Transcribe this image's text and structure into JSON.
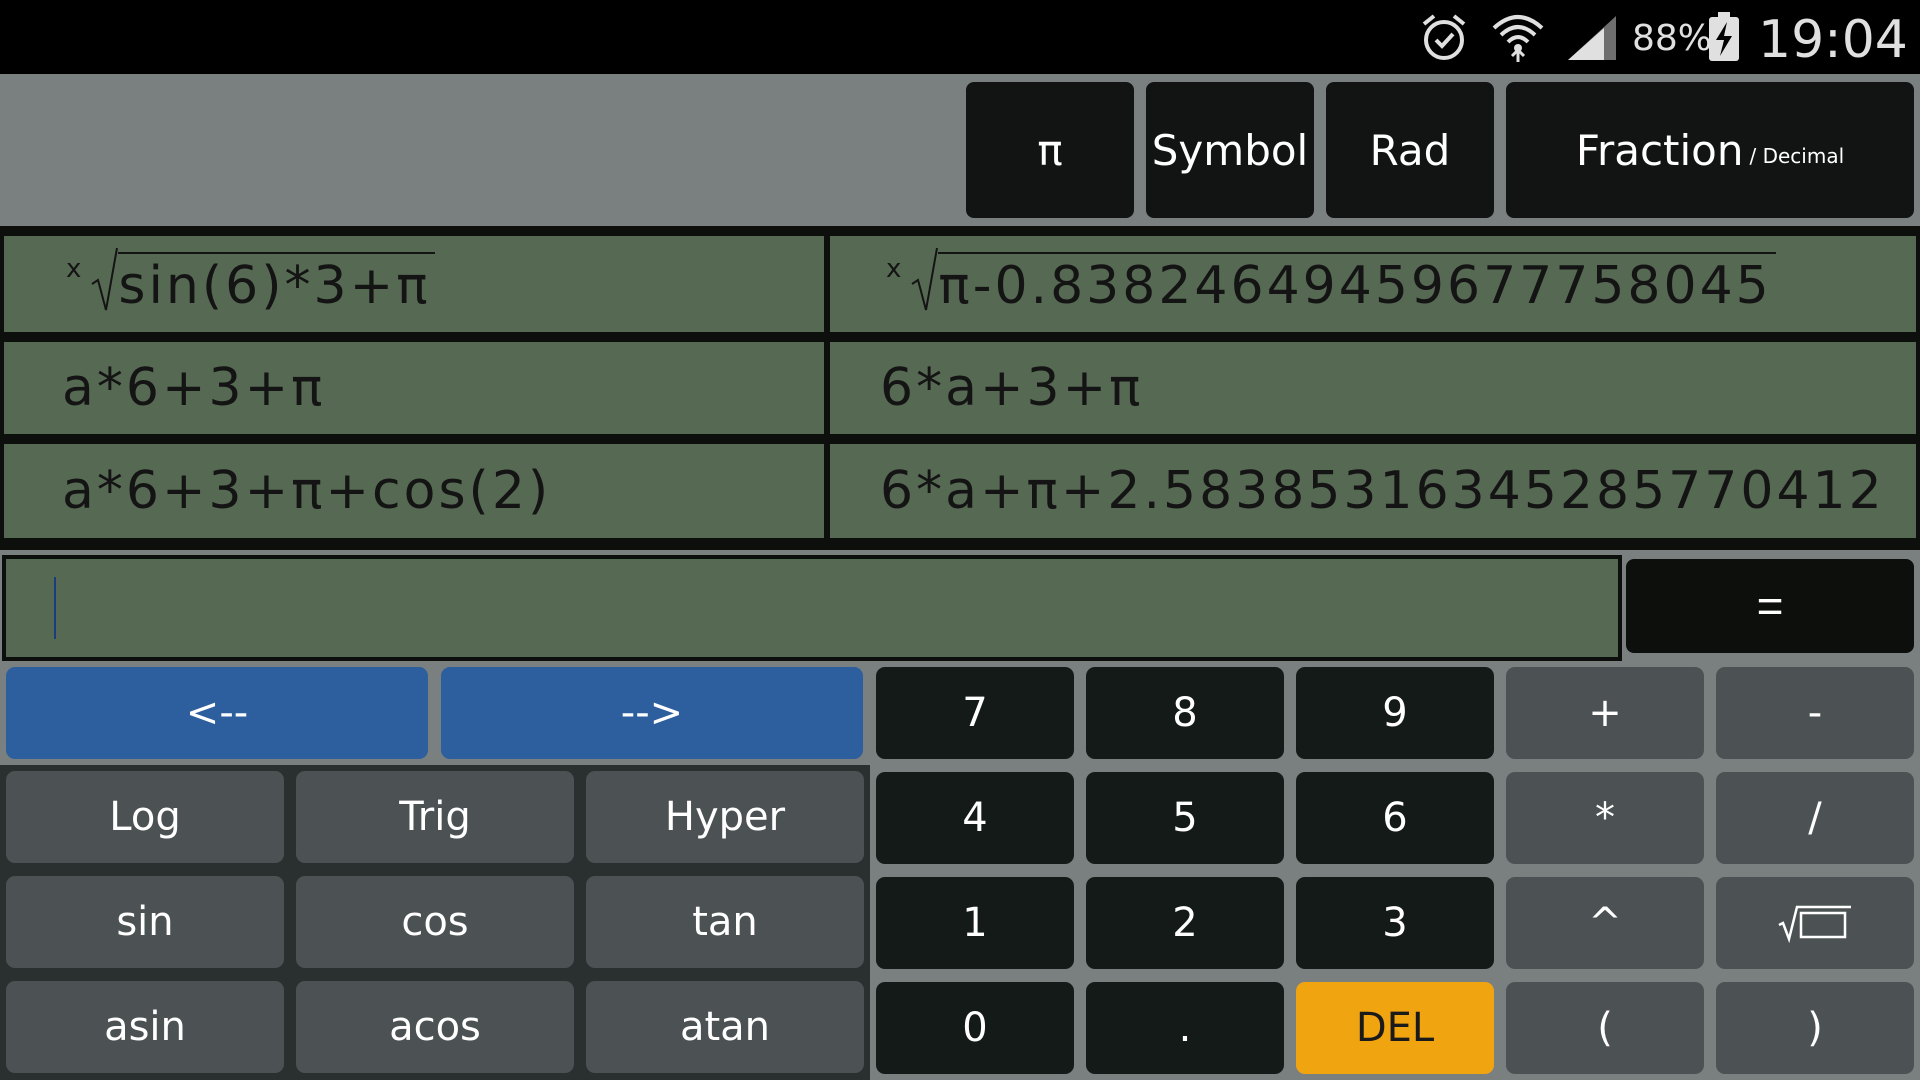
{
  "status": {
    "battery": "88%",
    "time": "19:04"
  },
  "top_buttons": {
    "pi": "π",
    "symbol": "Symbol",
    "rad": "Rad",
    "fraction": "Fraction",
    "fraction_sub": "/ Decimal"
  },
  "history": [
    {
      "input_index": "x",
      "input": "sin(6)*3+π",
      "output_index": "x",
      "output": "π-0.83824649459677758045"
    },
    {
      "input": "a*6+3+π",
      "output": "6*a+3+π"
    },
    {
      "input": "a*6+3+π+cos(2)",
      "output": "6*a+π+2.58385316345285770412"
    }
  ],
  "input": {
    "value": ""
  },
  "equals": "=",
  "keys": {
    "left_arrow": "<--",
    "right_arrow": "-->",
    "log": "Log",
    "trig": "Trig",
    "hyper": "Hyper",
    "sin": "sin",
    "cos": "cos",
    "tan": "tan",
    "asin": "asin",
    "acos": "acos",
    "atan": "atan",
    "n7": "7",
    "n8": "8",
    "n9": "9",
    "n4": "4",
    "n5": "5",
    "n6": "6",
    "n1": "1",
    "n2": "2",
    "n3": "3",
    "n0": "0",
    "dot": ".",
    "del": "DEL",
    "plus": "+",
    "minus": "-",
    "mult": "*",
    "div": "/",
    "pow": "^",
    "lparen": "(",
    "rparen": ")"
  },
  "colors": {
    "background": "#7a7f80",
    "display_green": "#566a53",
    "arrow_blue": "#2d5f9e",
    "del_orange": "#f0a410",
    "digit_dark": "#131a18",
    "func_grey": "#4c5254"
  },
  "icons": [
    "alarm-icon",
    "wifi-icon",
    "signal-icon",
    "battery-charging-icon",
    "sqrt-key-icon"
  ]
}
